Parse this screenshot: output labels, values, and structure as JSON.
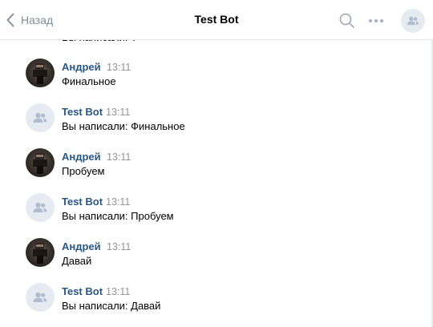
{
  "header": {
    "back_label": "Назад",
    "title": "Test Bot"
  },
  "partial_message_text": "Вы написали: Т",
  "messages": [
    {
      "author": "Андрей",
      "time": "13:11",
      "text": "Финальное"
    },
    {
      "author": "Test Bot",
      "time": "13:11",
      "text": "Вы написали: Финальное"
    },
    {
      "author": "Андрей",
      "time": "13:11",
      "text": "Пробуем"
    },
    {
      "author": "Test Bot",
      "time": "13:11",
      "text": "Вы написали: Пробуем"
    },
    {
      "author": "Андрей",
      "time": "13:11",
      "text": "Давай"
    },
    {
      "author": "Test Bot",
      "time": "13:11",
      "text": "Вы написали: Давай"
    }
  ],
  "colors": {
    "author_link": "#2a5885",
    "time_gray": "#939393",
    "icon_gray": "#818c99",
    "bot_avatar_bg": "#e5ebf1",
    "bot_avatar_icon": "#aebdd0"
  },
  "icons": {
    "back": "chevron-left-icon",
    "search": "search-icon",
    "more": "more-horizontal-icon",
    "group": "users-icon",
    "user_avatar": "user-photo"
  }
}
